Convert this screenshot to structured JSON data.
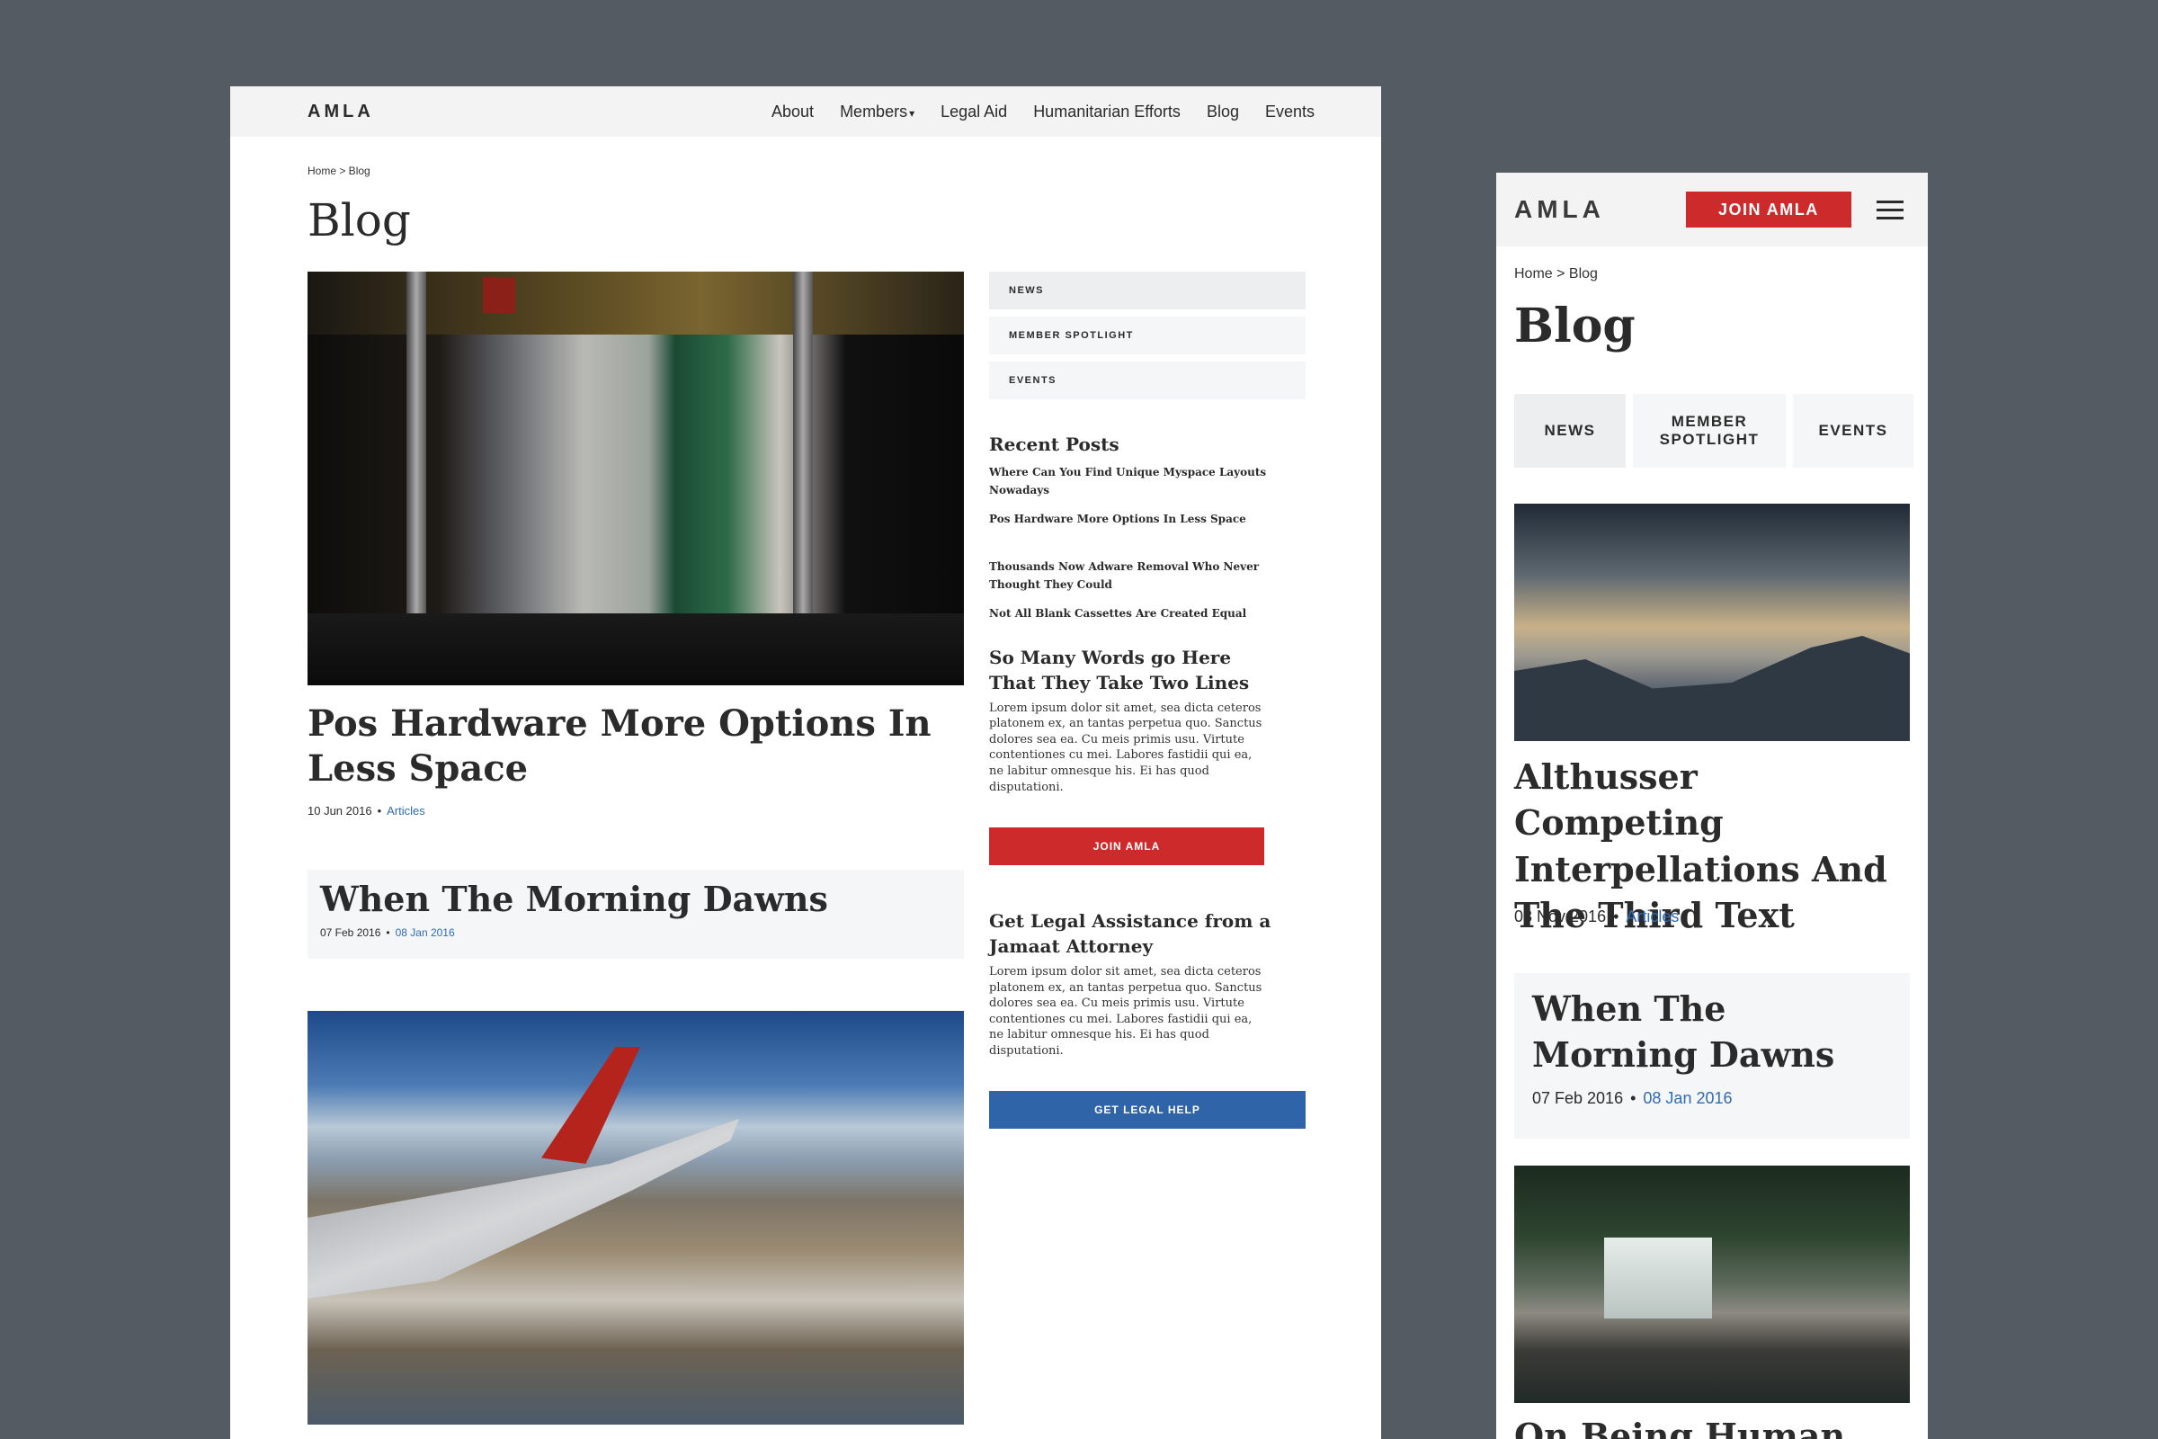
{
  "desktop": {
    "logo": "AMLA",
    "nav": [
      "About",
      "Members",
      "Legal Aid",
      "Humanitarian Efforts",
      "Blog",
      "Events"
    ],
    "members_caret": "▾",
    "breadcrumb": "Home > Blog",
    "page_title": "Blog",
    "posts": [
      {
        "title": "Pos Hardware More Options In Less Space",
        "date": "10 Jun 2016",
        "category": "Articles"
      },
      {
        "title": "When The Morning Dawns",
        "date": "07 Feb 2016",
        "category": "08 Jan 2016"
      }
    ],
    "sidebar": {
      "categories": [
        "NEWS",
        "MEMBER SPOTLIGHT",
        "EVENTS"
      ],
      "recent_heading": "Recent Posts",
      "recent_posts": [
        "Where Can You Find Unique Myspace Layouts Nowadays",
        "Pos Hardware More Options In Less Space",
        "Thousands Now Adware Removal Who Never Thought They Could",
        "Not All Blank Cassettes Are Created Equal"
      ],
      "two_lines_heading": "So Many Words go Here That They Take Two Lines",
      "two_lines_body": "Lorem ipsum dolor sit amet, sea dicta ceteros platonem ex, an tantas perpetua quo. Sanctus dolores sea ea. Cu meis primis usu. Virtute contentiones cu mei. Labores fastidii qui ea, ne labitur omnesque his. Ei has quod disputationi.",
      "join_button": "JOIN AMLA",
      "legal_heading": "Get Legal Assistance from a Jamaat Attorney",
      "legal_body": "Lorem ipsum dolor sit amet, sea dicta ceteros platonem ex, an tantas perpetua quo. Sanctus dolores sea ea. Cu meis primis usu. Virtute contentiones cu mei. Labores fastidii qui ea, ne labitur omnesque his. Ei has quod disputationi.",
      "legal_button": "GET LEGAL HELP"
    }
  },
  "mobile": {
    "logo": "AMLA",
    "join_button": "JOIN AMLA",
    "breadcrumb": "Home > Blog",
    "page_title": "Blog",
    "tabs": [
      "NEWS",
      "MEMBER SPOTLIGHT",
      "EVENTS"
    ],
    "posts": [
      {
        "title": "Althusser Competing Interpellations And The Third Text",
        "date": "03 Nov 2016",
        "category": "Articles"
      },
      {
        "title": "When The Morning Dawns",
        "date": "07 Feb 2016",
        "category": "08 Jan 2016"
      },
      {
        "title": "On Being Human"
      }
    ]
  },
  "colors": {
    "backdrop": "#545b63",
    "accent_red": "#cd2b2b",
    "accent_blue": "#2f64a8",
    "link_blue": "#2f6bb5"
  }
}
